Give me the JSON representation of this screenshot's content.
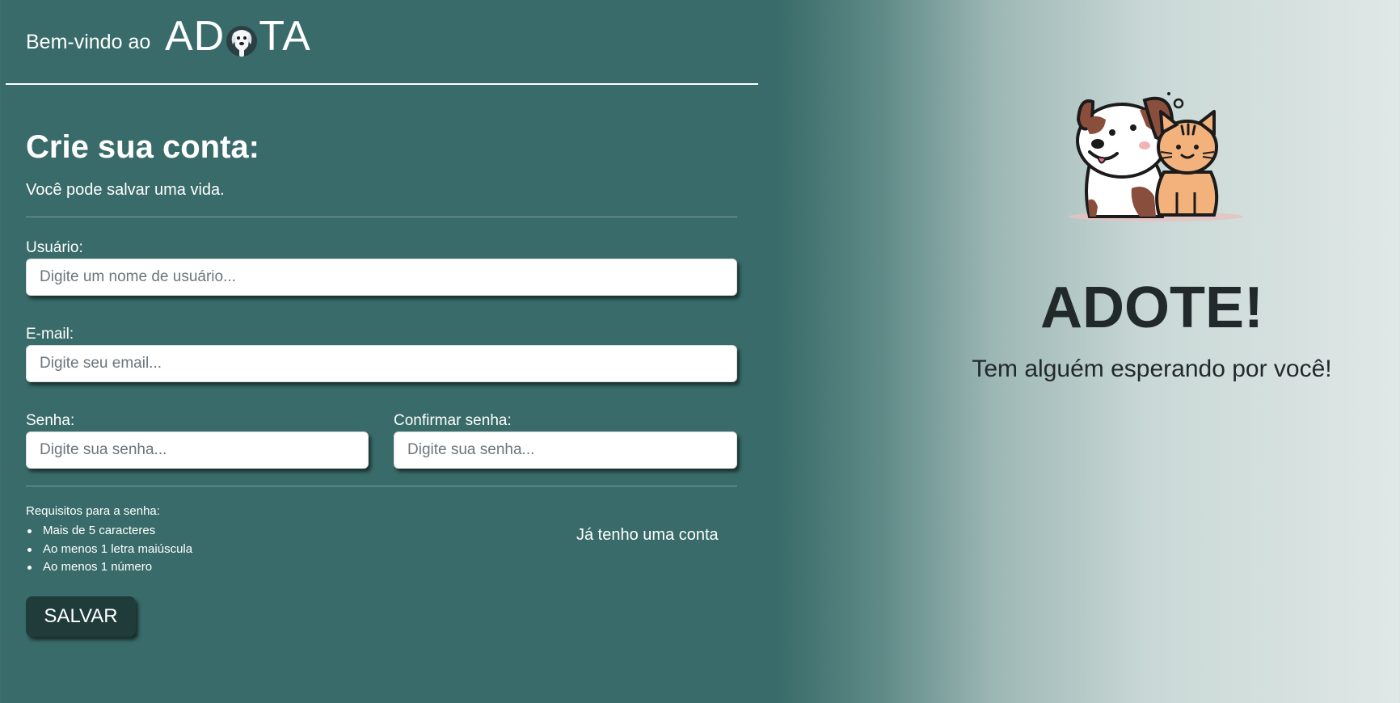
{
  "header": {
    "welcome": "Bem-vindo ao",
    "logo_left": "AD",
    "logo_right": "TA"
  },
  "form": {
    "title": "Crie sua conta:",
    "subtitle": "Você pode salvar uma vida.",
    "username": {
      "label": "Usuário:",
      "placeholder": "Digite um nome de usuário...",
      "value": ""
    },
    "email": {
      "label": "E-mail:",
      "placeholder": "Digite seu email...",
      "value": ""
    },
    "password": {
      "label": "Senha:",
      "placeholder": "Digite sua senha...",
      "value": ""
    },
    "confirm_password": {
      "label": "Confirmar senha:",
      "placeholder": "Digite sua senha...",
      "value": ""
    },
    "requirements_title": "Requisitos para a senha:",
    "requirements": [
      "Mais de 5 caracteres",
      "Ao menos 1 letra maiúscula",
      "Ao menos 1 número"
    ],
    "login_link": "Já tenho uma conta",
    "save_label": "SALVAR"
  },
  "hero": {
    "illustration_icon": "dog-and-cat-illustration",
    "title": "ADOTE!",
    "tagline": "Tem alguém esperando por você!"
  },
  "colors": {
    "primary": "#386b69",
    "button": "#1f3b3a",
    "text_dark": "#22292b"
  }
}
